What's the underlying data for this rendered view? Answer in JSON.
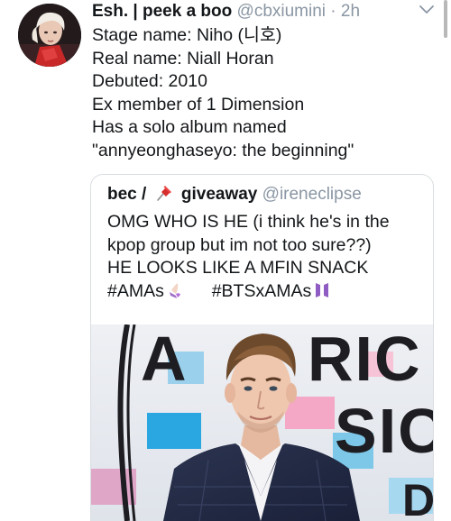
{
  "tweet": {
    "display_name": "Esh. | peek a boo",
    "handle": "@cbxiumini",
    "separator": "·",
    "time": "2h",
    "lines": [
      "Stage name: Niho (니호)",
      "Real name: Niall Horan",
      "Debuted: 2010",
      "Ex member of 1 Dimension",
      "Has a solo album named",
      "\"annyeonghaseyo: the beginning\""
    ]
  },
  "quoted_tweet": {
    "display_name_before": "bec /",
    "display_name_after": "giveaway",
    "handle": "@ireneclipse",
    "lines": [
      "OMG WHO IS HE (i think he's in the",
      "kpop group but im not too sure??)",
      "HE LOOKS LIKE A MFIN SNACK"
    ],
    "hashtag_1": "#AMAs",
    "hashtag_2": "#BTSxAMAs",
    "photo_backdrop_text": "AMERICAN MUSIC"
  },
  "icons": {
    "avatar": "profile-photo",
    "caret": "chevron-down-icon",
    "pin": "pushpin-emoji",
    "nail_polish": "nail-polish-emoji",
    "bts_logo": "bts-logo-emoji"
  },
  "colors": {
    "text": "#14171a",
    "secondary": "#8a96a3",
    "border": "#d9dee2"
  }
}
